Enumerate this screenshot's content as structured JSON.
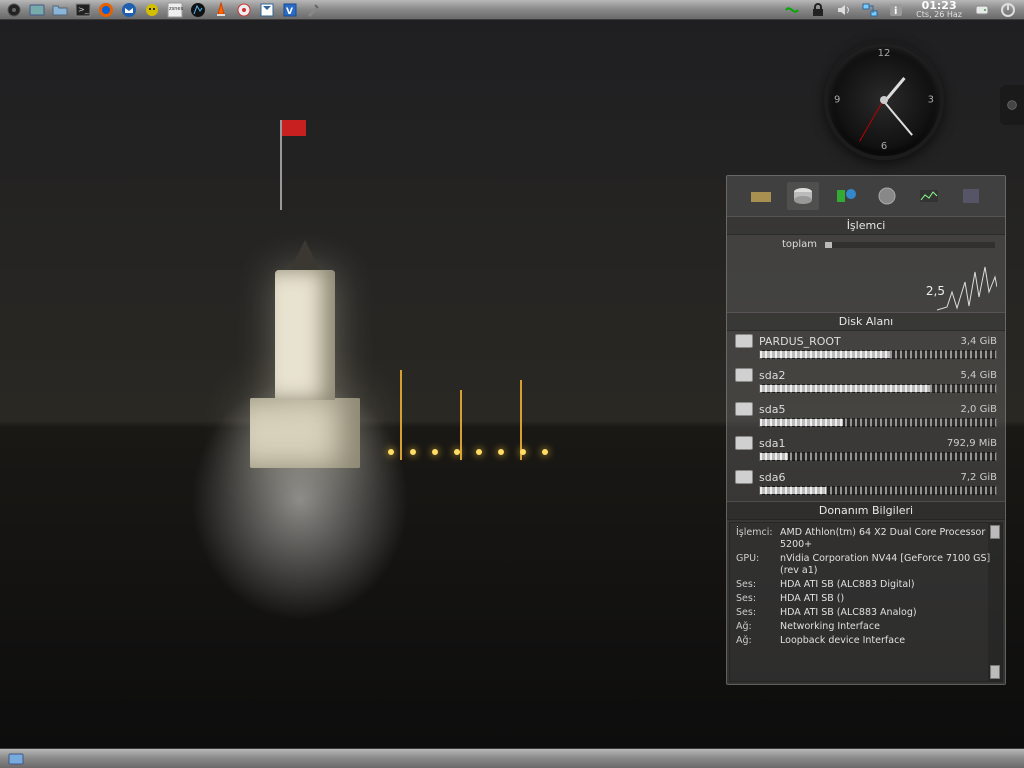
{
  "clock": {
    "time": "01:23",
    "date": "Cts, 26 Haz"
  },
  "analog_clock": {
    "n12": "12",
    "n3": "3",
    "n6": "6",
    "n9": "9"
  },
  "sysmon": {
    "cpu_header": "İşlemci",
    "cpu_total_label": "toplam",
    "cpu_value": "2,5",
    "disk_header": "Disk Alanı",
    "disks": [
      {
        "name": "PARDUS_ROOT",
        "size": "3,4 GiB",
        "fill": 55
      },
      {
        "name": "sda2",
        "size": "5,4 GiB",
        "fill": 72
      },
      {
        "name": "sda5",
        "size": "2,0 GiB",
        "fill": 35
      },
      {
        "name": "sda1",
        "size": "792,9 MiB",
        "fill": 12
      },
      {
        "name": "sda6",
        "size": "7,2 GiB",
        "fill": 28
      }
    ],
    "hw_header": "Donanım Bilgileri",
    "hw": [
      {
        "key": "İşlemci:",
        "val": "AMD Athlon(tm) 64 X2 Dual Core Processor 5200+"
      },
      {
        "key": "GPU:",
        "val": "nVidia Corporation NV44 [GeForce 7100 GS] (rev a1)"
      },
      {
        "key": "Ses:",
        "val": "HDA ATI SB (ALC883 Digital)"
      },
      {
        "key": "Ses:",
        "val": "HDA ATI SB ()"
      },
      {
        "key": "Ses:",
        "val": "HDA ATI SB (ALC883 Analog)"
      },
      {
        "key": "Ağ:",
        "val": "Networking Interface"
      },
      {
        "key": "Ağ:",
        "val": "Loopback device Interface"
      }
    ]
  }
}
